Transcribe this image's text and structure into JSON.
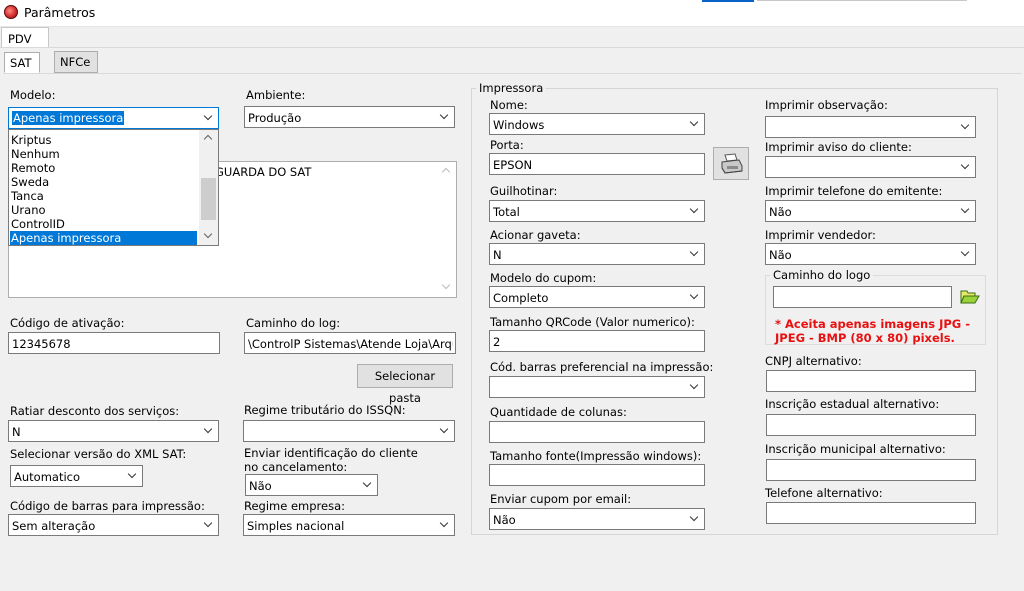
{
  "window": {
    "title": "Parâmetros"
  },
  "tabs": {
    "pdv": "PDV"
  },
  "subtabs": {
    "sat": "SAT",
    "nfce": "NFCe"
  },
  "left": {
    "modelo_label": "Modelo:",
    "modelo_value": "Apenas impressora",
    "modelo_options": [
      "Kriptus",
      "Nenhum",
      "Remoto",
      "Sweda",
      "Tanca",
      "Urano",
      "ControlID",
      "Apenas impressora"
    ],
    "ambiente_label": "Ambiente:",
    "ambiente_value": "Produção",
    "textarea_partial": "GUARDA DO SAT",
    "codigo_ativacao_label": "Código de ativação:",
    "codigo_ativacao_value": "12345678",
    "caminho_log_label": "Caminho do log:",
    "caminho_log_value": "\\ControlP Sistemas\\Atende Loja\\Arquiv",
    "selecionar_pasta": "Selecionar pasta",
    "ratiar_label": "Ratiar desconto dos serviços:",
    "ratiar_value": "N",
    "regime_issqn_label": "Regime tributário do ISSQN:",
    "regime_issqn_value": "",
    "versao_xml_label": "Selecionar versão do XML SAT:",
    "versao_xml_value": "Automatico",
    "enviar_ident_label_1": "Enviar identificação do cliente",
    "enviar_ident_label_2": "no cancelamento:",
    "enviar_ident_value": "Não",
    "codigo_barras_label": "Código de barras para impressão:",
    "codigo_barras_value": "Sem alteração",
    "regime_empresa_label": "Regime empresa:",
    "regime_empresa_value": "Simples nacional"
  },
  "impressora": {
    "title": "Impressora",
    "nome_label": "Nome:",
    "nome_value": "Windows",
    "porta_label": "Porta:",
    "porta_value": "EPSON",
    "guilhotinar_label": "Guilhotinar:",
    "guilhotinar_value": "Total",
    "gaveta_label": "Acionar gaveta:",
    "gaveta_value": "N",
    "modelo_cupom_label": "Modelo do cupom:",
    "modelo_cupom_value": "Completo",
    "qrcode_label": "Tamanho QRCode (Valor numerico):",
    "qrcode_value": "2",
    "cod_barras_pref_label": "Cód. barras preferencial na impressão:",
    "cod_barras_pref_value": "",
    "colunas_label": "Quantidade de colunas:",
    "colunas_value": "",
    "fonte_label": "Tamanho fonte(Impressão windows):",
    "fonte_value": "",
    "email_label": "Enviar cupom por email:",
    "email_value": "Não",
    "obs_label": "Imprimir observação:",
    "obs_value": "",
    "aviso_label": "Imprimir aviso do cliente:",
    "aviso_value": "",
    "telefone_label": "Imprimir telefone do emitente:",
    "telefone_value": "Não",
    "vendedor_label": "Imprimir vendedor:",
    "vendedor_value": "Não",
    "logo_title": "Caminho do logo",
    "logo_value": "",
    "logo_warning_1": "* Aceita apenas imagens JPG -",
    "logo_warning_2": "JPEG - BMP (80 x 80) pixels.",
    "cnpj_label": "CNPJ alternativo:",
    "cnpj_value": "",
    "ie_label": "Inscrição estadual alternativo:",
    "ie_value": "",
    "im_label": "Inscrição municipal alternativo:",
    "im_value": "",
    "tel_alt_label": "Telefone alternativo:",
    "tel_alt_value": ""
  }
}
